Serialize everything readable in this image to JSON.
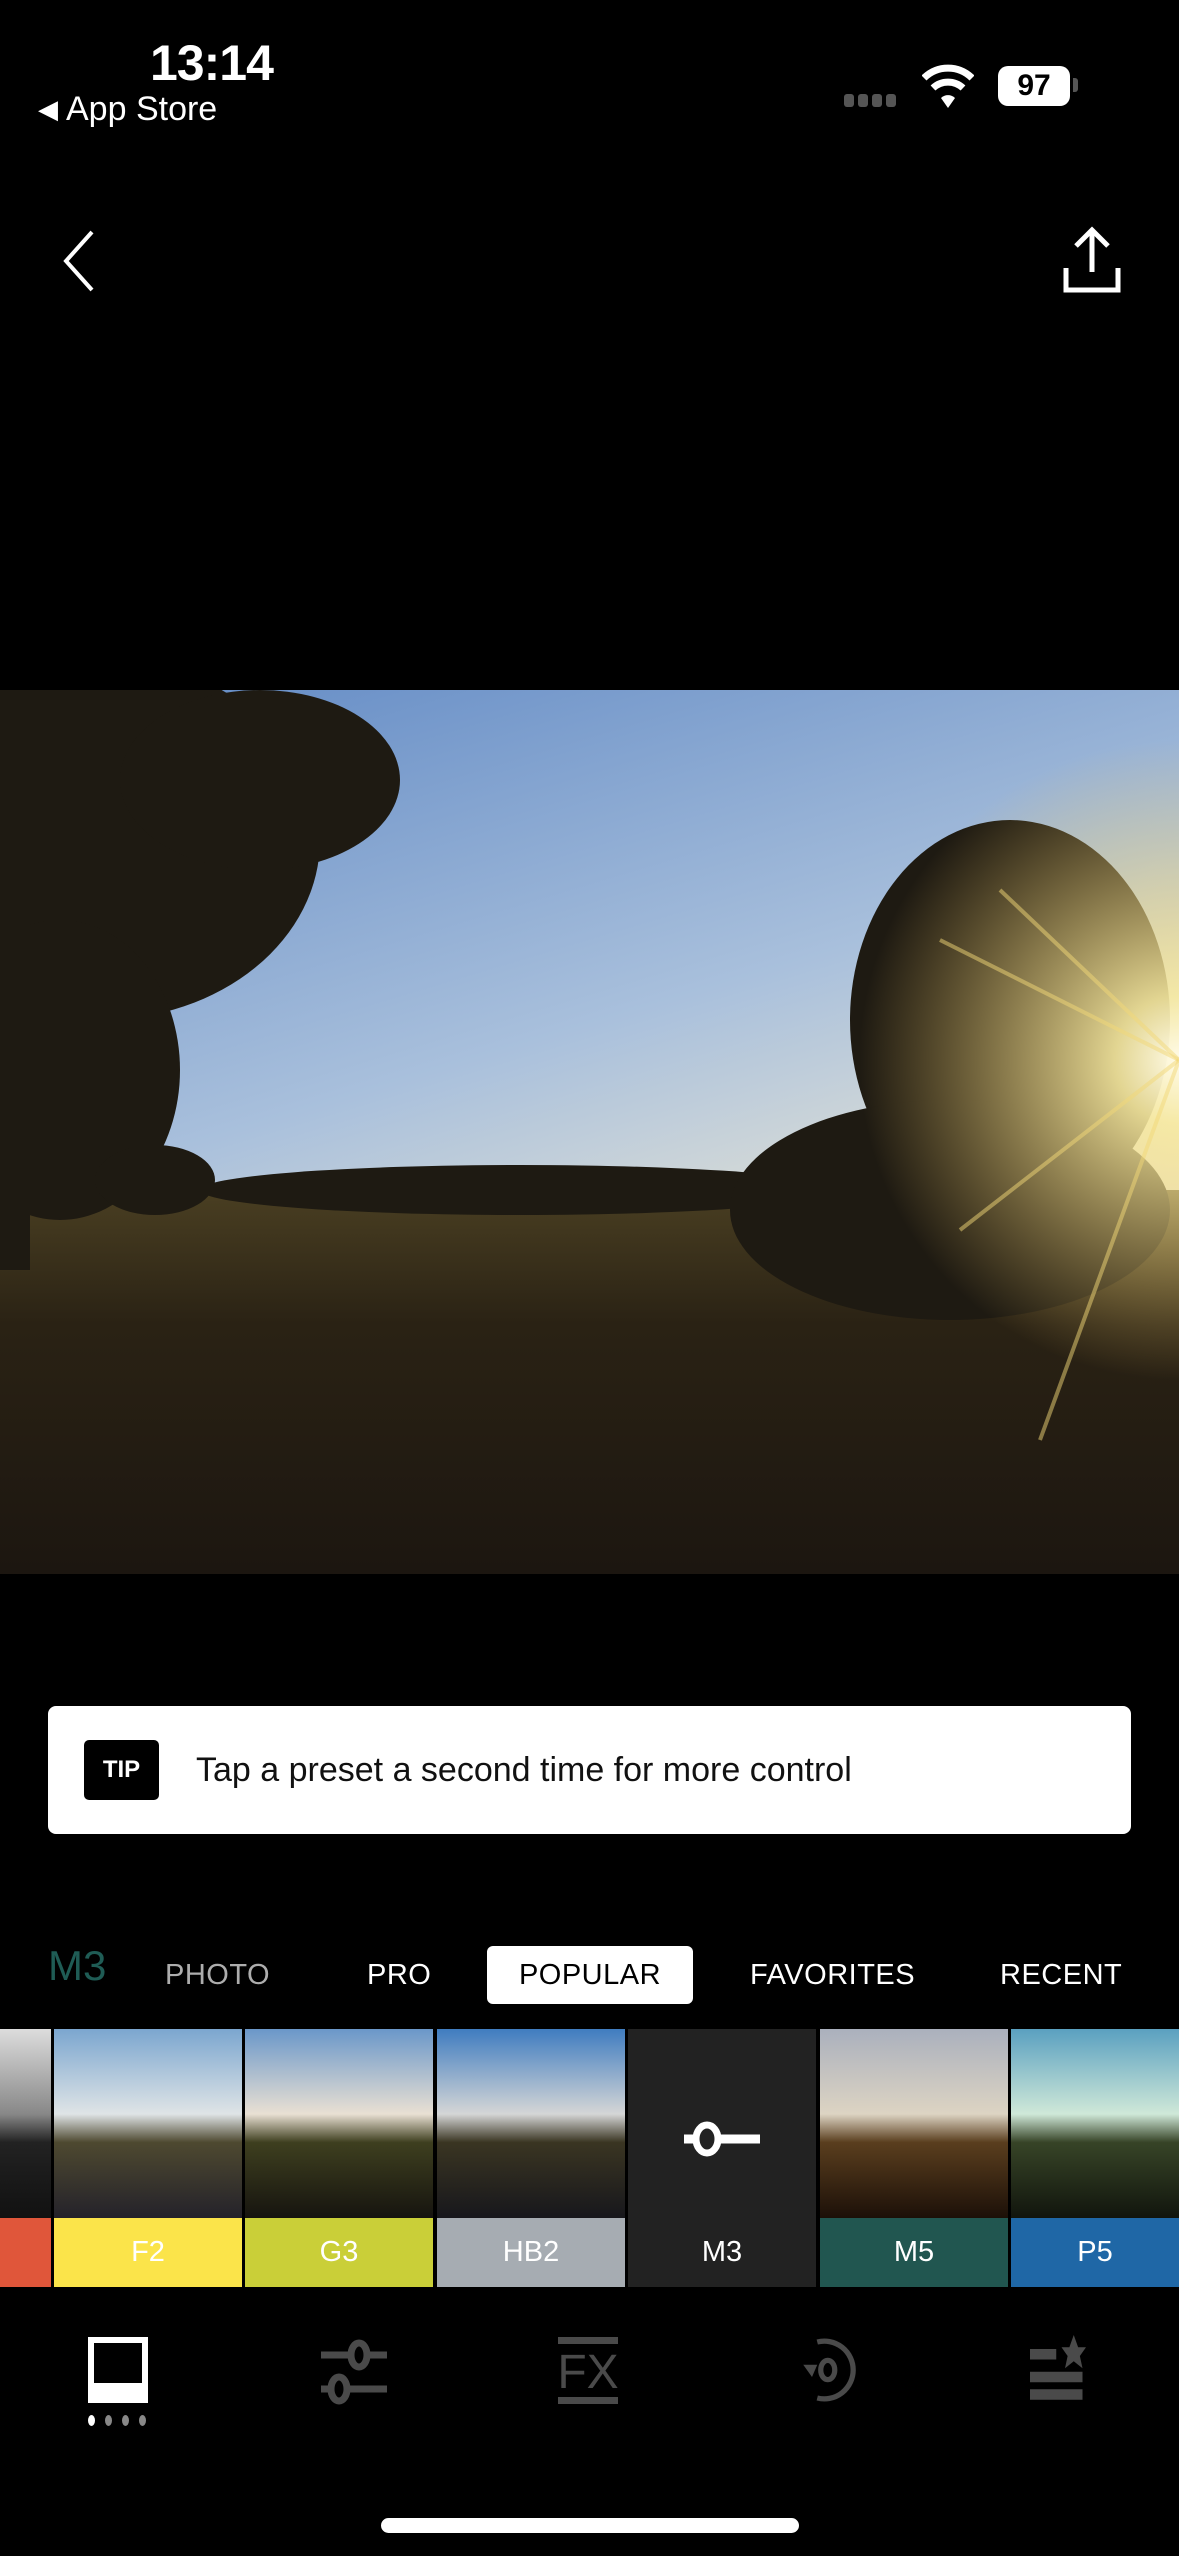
{
  "status_bar": {
    "time": "13:14",
    "back_app": "App Store",
    "battery": "97"
  },
  "nav": {
    "back_icon": "chevron-left-icon",
    "share_icon": "share-upload-icon"
  },
  "tip": {
    "badge": "TIP",
    "text": "Tap a preset a second time for more control"
  },
  "current_preset": {
    "label": "M3",
    "color": "#1f5c55"
  },
  "tabs": [
    {
      "label": "PHOTO"
    },
    {
      "label": "PRO"
    },
    {
      "label": "POPULAR",
      "selected": true
    },
    {
      "label": "FAVORITES"
    },
    {
      "label": "RECENT"
    }
  ],
  "presets": [
    {
      "label": "",
      "color": "#e0563a"
    },
    {
      "label": "F2",
      "color": "#fbe44a"
    },
    {
      "label": "G3",
      "color": "#cacf38"
    },
    {
      "label": "HB2",
      "color": "#a6acb2"
    },
    {
      "label": "M3",
      "color": "#222222",
      "selected": true,
      "icon": "adjust-slider-icon"
    },
    {
      "label": "M5",
      "color": "#215650"
    },
    {
      "label": "P5",
      "color": "#1f67a6"
    }
  ],
  "toolbar": [
    {
      "name": "presets",
      "icon": "presets-frame-icon",
      "active": true
    },
    {
      "name": "adjust",
      "icon": "sliders-icon"
    },
    {
      "name": "fx",
      "icon": "fx-icon",
      "label": "FX"
    },
    {
      "name": "history",
      "icon": "history-icon"
    },
    {
      "name": "recipes",
      "icon": "recipes-star-list-icon"
    }
  ]
}
